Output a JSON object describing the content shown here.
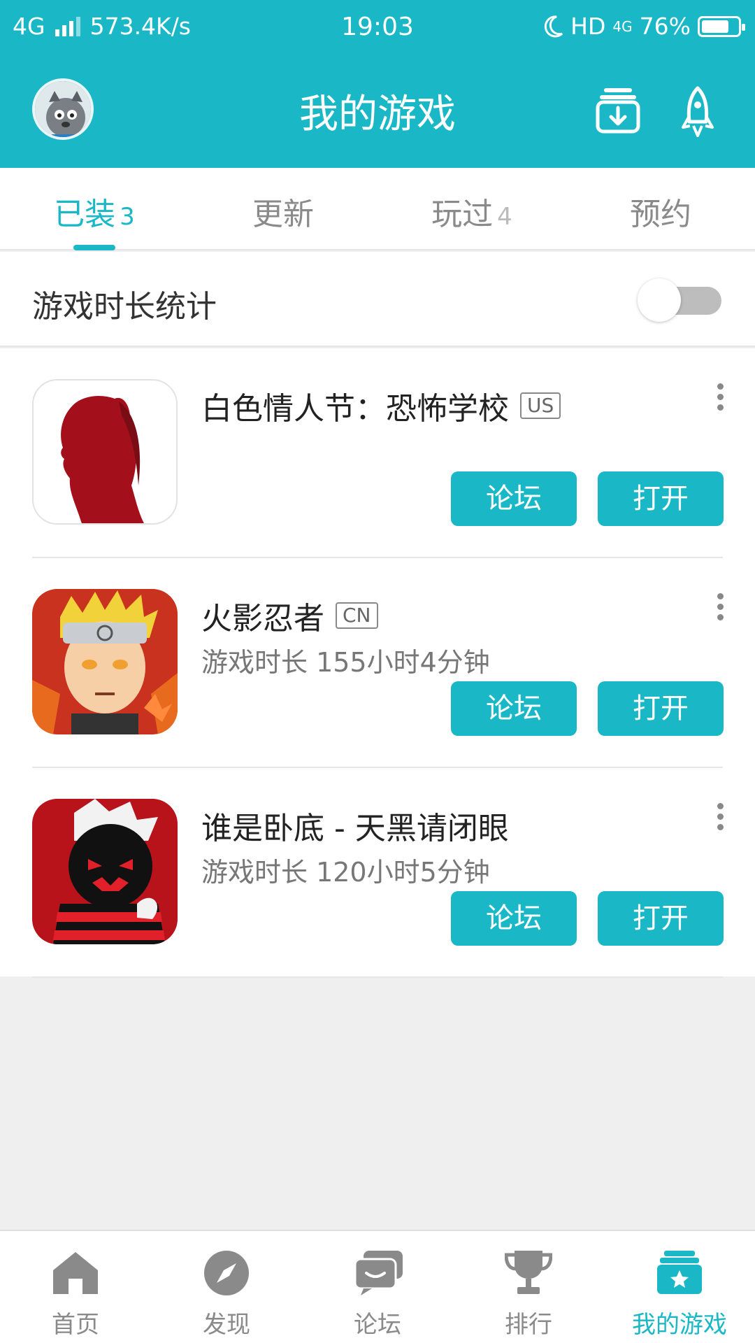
{
  "status_bar": {
    "network": "4G",
    "speed": "573.4K/s",
    "time": "19:03",
    "hd": "HD",
    "net2": "4G",
    "battery": "76%",
    "battery_level": 0.76
  },
  "header": {
    "title": "我的游戏"
  },
  "tabs": [
    {
      "label": "已装",
      "count": "3",
      "active": true
    },
    {
      "label": "更新",
      "count": ""
    },
    {
      "label": "玩过",
      "count": "4"
    },
    {
      "label": "预约",
      "count": ""
    }
  ],
  "stats": {
    "label": "游戏时长统计",
    "enabled": false
  },
  "games": [
    {
      "name": "白色情人节：恐怖学校",
      "region": "US",
      "playtime": "",
      "forum_label": "论坛",
      "open_label": "打开"
    },
    {
      "name": "火影忍者",
      "region": "CN",
      "playtime": "游戏时长 155小时4分钟",
      "forum_label": "论坛",
      "open_label": "打开"
    },
    {
      "name": "谁是卧底 - 天黑请闭眼",
      "region": "",
      "playtime": "游戏时长 120小时5分钟",
      "forum_label": "论坛",
      "open_label": "打开"
    }
  ],
  "bottom_nav": [
    {
      "label": "首页",
      "icon": "home-icon"
    },
    {
      "label": "发现",
      "icon": "compass-icon"
    },
    {
      "label": "论坛",
      "icon": "chat-icon"
    },
    {
      "label": "排行",
      "icon": "trophy-icon"
    },
    {
      "label": "我的游戏",
      "icon": "star-stack-icon",
      "active": true
    }
  ],
  "colors": {
    "accent": "#1ab8c6",
    "background": "#efefef"
  }
}
